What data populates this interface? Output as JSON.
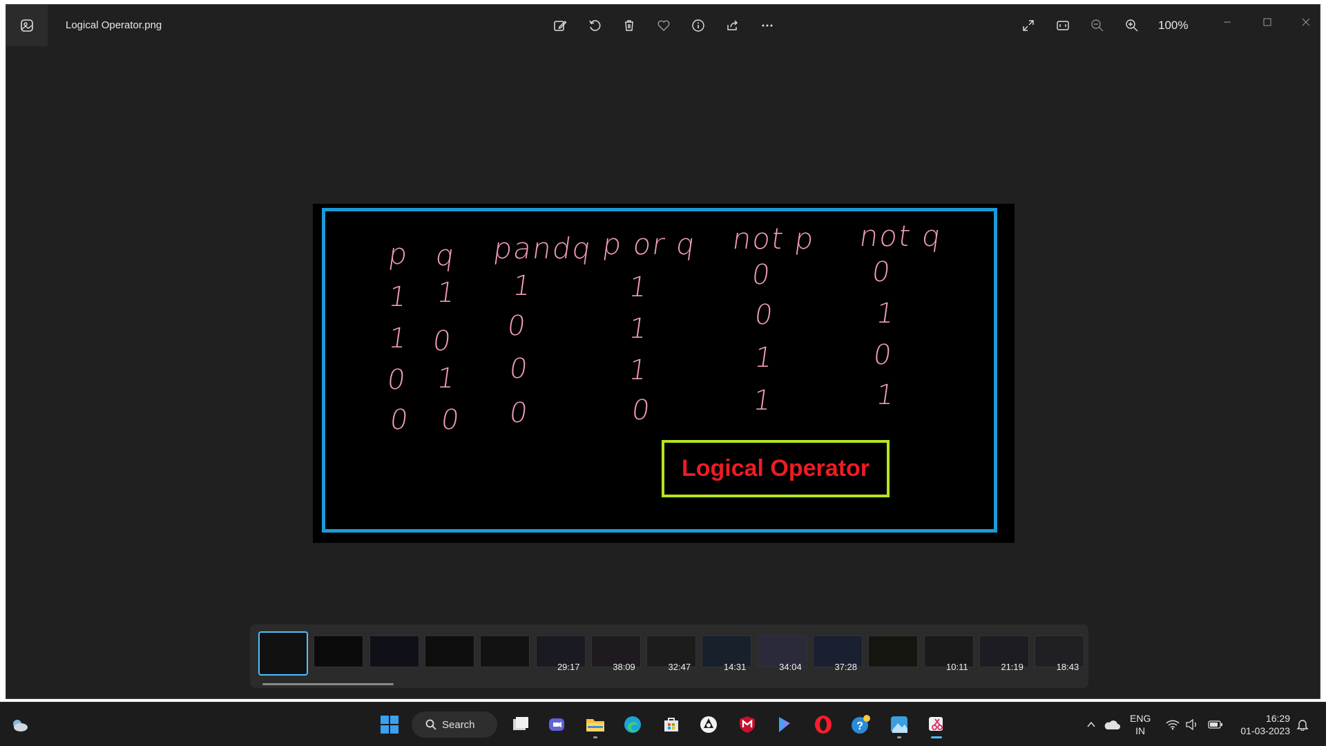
{
  "window": {
    "title": "Logical Operator.png",
    "zoom": "100%"
  },
  "toolbar": {
    "icons": [
      "edit-image-icon",
      "rotate-icon",
      "delete-icon",
      "favorite-icon",
      "info-icon",
      "share-icon",
      "more-icon"
    ],
    "right_icons": [
      "fullscreen-icon",
      "fit-window-icon",
      "zoom-out-icon",
      "zoom-in-icon"
    ]
  },
  "image": {
    "headers": [
      "p",
      "q",
      "pandq",
      "p or q",
      "not p",
      "not q"
    ],
    "columns": [
      [
        "1",
        "1",
        "0",
        "0"
      ],
      [
        "1",
        "0",
        "1",
        "0"
      ],
      [
        "1",
        "0",
        "0",
        "0"
      ],
      [
        "1",
        "1",
        "1",
        "0"
      ],
      [
        "0",
        "0",
        "1",
        "1"
      ],
      [
        "0",
        "1",
        "0",
        "1"
      ]
    ],
    "label": "Logical Operator",
    "colors": {
      "frame": "#1a9ad6",
      "handwriting": "#f29bc0",
      "label_border": "#b5e61d",
      "label_text": "#ed1c24"
    }
  },
  "filmstrip": {
    "items": [
      {
        "duration": ""
      },
      {
        "duration": ""
      },
      {
        "duration": ""
      },
      {
        "duration": ""
      },
      {
        "duration": ""
      },
      {
        "duration": "29:17"
      },
      {
        "duration": "38:09"
      },
      {
        "duration": "32:47"
      },
      {
        "duration": "14:31"
      },
      {
        "duration": "34:04"
      },
      {
        "duration": "37:28"
      },
      {
        "duration": ""
      },
      {
        "duration": "10:11"
      },
      {
        "duration": "21:19"
      },
      {
        "duration": "18:43"
      }
    ]
  },
  "taskbar": {
    "search_label": "Search",
    "language": [
      "ENG",
      "IN"
    ],
    "time": "16:29",
    "date": "01-03-2023"
  }
}
